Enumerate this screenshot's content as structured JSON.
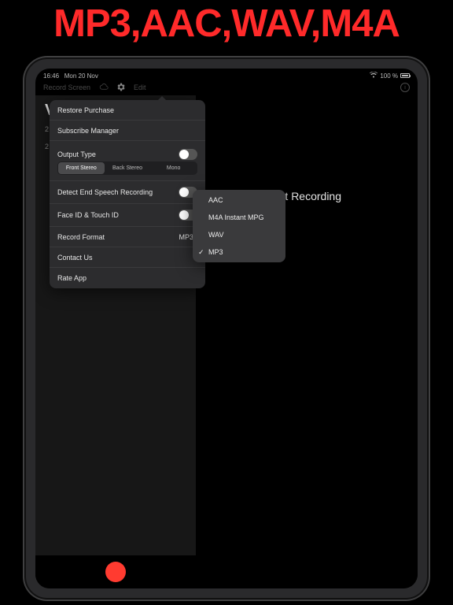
{
  "promo": {
    "title": "MP3,AAC,WAV,M4A"
  },
  "status": {
    "time": "16:46",
    "date": "Mon 20 Nov",
    "battery_pct": "100 %"
  },
  "tabs": {
    "record_screen": "Record Screen",
    "edit": "Edit"
  },
  "main": {
    "start_recording": "tart Recording"
  },
  "background_list": {
    "letter": "V",
    "n1": "2",
    "n2": "2"
  },
  "settings": {
    "restore_purchase": "Restore Purchase",
    "subscribe_manager": "Subscribe Manager",
    "output_type": "Output Type",
    "segments": {
      "front": "Front Stereo",
      "back": "Back Stereo",
      "mono": "Mono"
    },
    "detect_end": "Detect End Speech Recording",
    "face_touch": "Face ID & Touch ID",
    "record_format": "Record Format",
    "record_format_value": "MP3",
    "contact_us": "Contact Us",
    "rate_app": "Rate App"
  },
  "formats": {
    "aac": "AAC",
    "m4a": "M4A Instant MPG",
    "wav": "WAV",
    "mp3": "MP3"
  }
}
